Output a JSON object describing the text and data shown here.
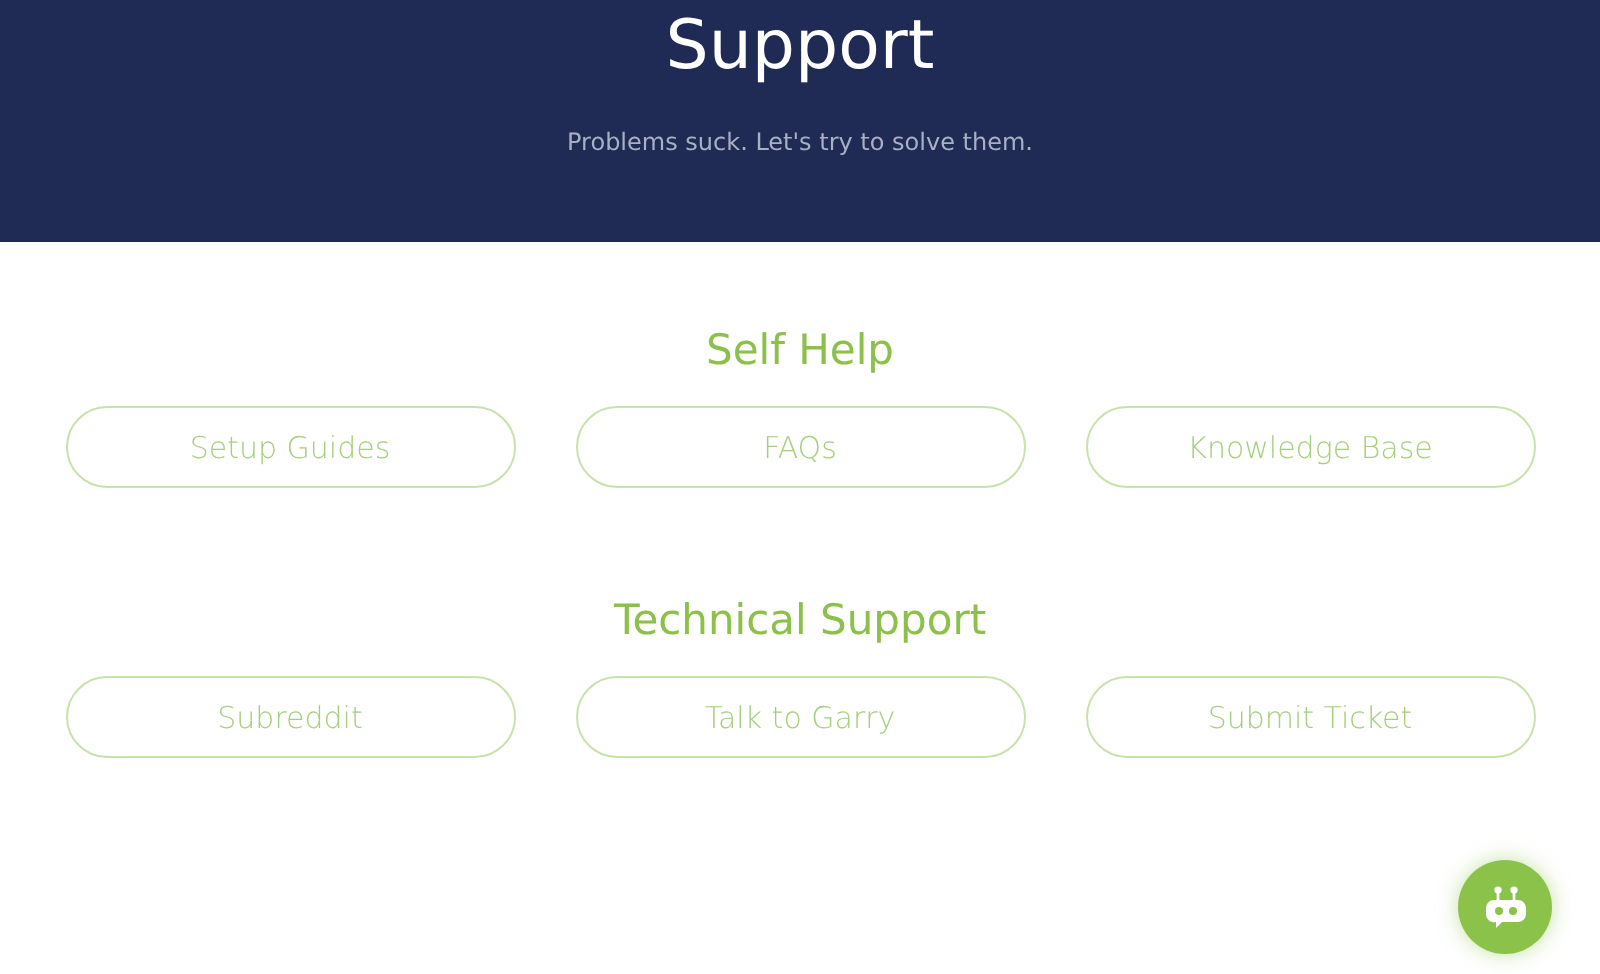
{
  "header": {
    "title": "Support",
    "subtitle": "Problems suck. Let's try to solve them."
  },
  "sections": [
    {
      "title": "Self Help",
      "buttons": [
        "Setup Guides",
        "FAQs",
        "Knowledge Base"
      ]
    },
    {
      "title": "Technical Support",
      "buttons": [
        "Subreddit",
        "Talk to Garry",
        "Submit Ticket"
      ]
    }
  ]
}
